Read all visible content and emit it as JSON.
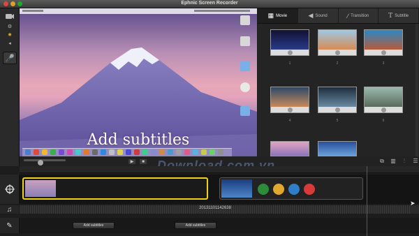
{
  "window": {
    "title": "Ephnic Screen Recorder"
  },
  "tabs": [
    {
      "label": "Movie",
      "icon": "film-icon"
    },
    {
      "label": "Sound",
      "icon": "speaker-icon"
    },
    {
      "label": "Transition",
      "icon": "transition-icon"
    },
    {
      "label": "Subtitle",
      "icon": "text-icon"
    }
  ],
  "preview": {
    "caption": "Add subtitles"
  },
  "thumbnails": [
    {
      "number": "1",
      "color_top": "#111133",
      "color_bottom": "#2a3a8a"
    },
    {
      "number": "2",
      "color_top": "#9ec9e6",
      "color_bottom": "#d88a52"
    },
    {
      "number": "3",
      "color_top": "#2a88c4",
      "color_bottom": "#b85a3a"
    },
    {
      "number": "4",
      "color_top": "#2b4a6a",
      "color_bottom": "#c88a5a"
    },
    {
      "number": "5",
      "color_top": "#1e2e3e",
      "color_bottom": "#6a8aa2"
    },
    {
      "number": "6",
      "color_top": "#9abab0",
      "color_bottom": "#5a6a5a"
    },
    {
      "number": "",
      "color_top": "#e3a5c2",
      "color_bottom": "#8c74b8"
    },
    {
      "number": "",
      "color_top": "#2a4f9c",
      "color_bottom": "#6aa0da"
    }
  ],
  "timeline": {
    "audio_label": "20131101142638",
    "subtitle_buttons": [
      "Add subtitles",
      "Add subtitles"
    ],
    "transition_dots": [
      "#2d8c3a",
      "#e0a82c",
      "#2f7fc8",
      "#d83a3a"
    ]
  },
  "watermark": "Download.com.vn"
}
